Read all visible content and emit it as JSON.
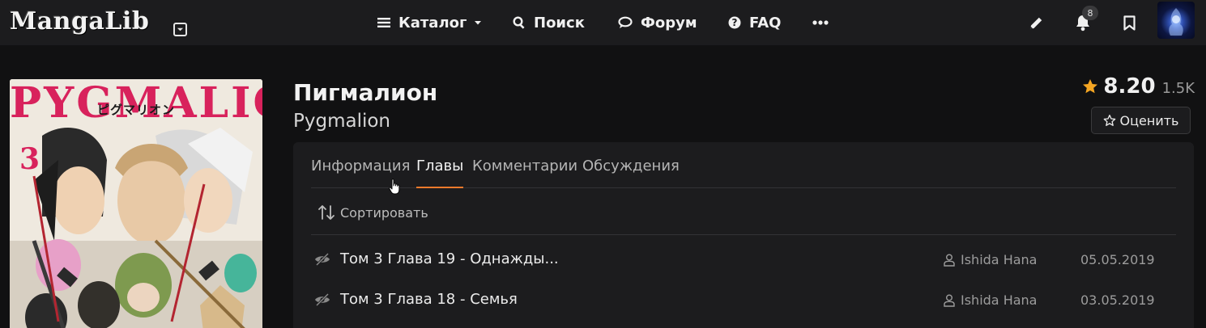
{
  "header": {
    "logo": "MangaLib",
    "nav": [
      {
        "label": "Каталог",
        "icon": "list-icon"
      },
      {
        "label": "Поиск",
        "icon": "search-icon"
      },
      {
        "label": "Форум",
        "icon": "chat-icon"
      },
      {
        "label": "FAQ",
        "icon": "question-icon"
      }
    ],
    "notifications_count": "8"
  },
  "manga": {
    "title": "Пигмалион",
    "subtitle": "Pygmalion",
    "rating": "8.20",
    "votes": "1.5K",
    "rate_button": "Оценить",
    "cover": {
      "title": "PYGMALION",
      "subtitle": "ピグマリオン",
      "volume": "3"
    }
  },
  "tabs": [
    "Информация",
    "Главы",
    "Комментарии",
    "Обсуждения"
  ],
  "active_tab": "Главы",
  "sort_label": "Сортировать",
  "chapters": [
    {
      "title": "Том 3 Глава 19 - Однажды...",
      "user": "Ishida Hana",
      "date": "05.05.2019"
    },
    {
      "title": "Том 3 Глава 18 - Семья",
      "user": "Ishida Hana",
      "date": "03.05.2019"
    }
  ],
  "colors": {
    "accent": "#f17a2b",
    "star": "#f5a623",
    "background": "#111112",
    "panel": "#1c1c1e"
  }
}
